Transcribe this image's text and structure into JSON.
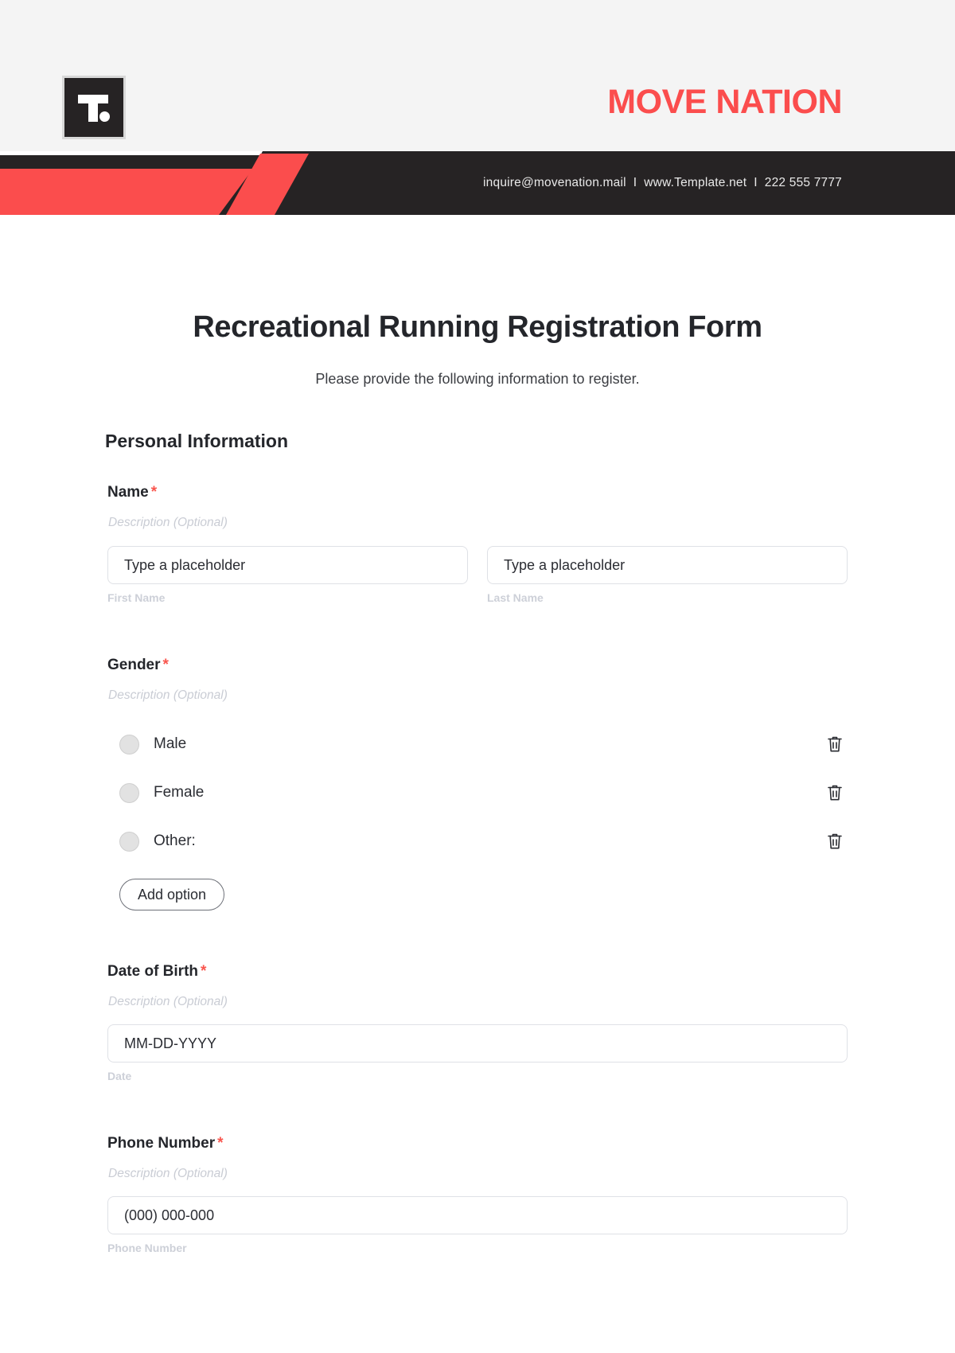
{
  "header": {
    "logo_letter": "T.",
    "brand": "MOVE NATION",
    "contact": {
      "email": "inquire@movenation.mail",
      "website": "www.Template.net",
      "phone": "222 555 7777",
      "separator": "I"
    },
    "colors": {
      "accent_red": "#fb4d4d",
      "dark": "#262324",
      "header_bg": "#f4f4f4"
    }
  },
  "form": {
    "title": "Recreational Running Registration Form",
    "subtitle": "Please provide the following information to register.",
    "section_heading": "Personal Information",
    "required_mark": "*",
    "description_placeholder": "Description (Optional)",
    "fields": [
      {
        "label": "Name",
        "required": true,
        "description": "Description (Optional)",
        "type": "name",
        "inputs": [
          {
            "value": "Type a placeholder",
            "sublabel": "First Name"
          },
          {
            "value": "Type a placeholder",
            "sublabel": "Last Name"
          }
        ]
      },
      {
        "label": "Gender",
        "required": true,
        "description": "Description (Optional)",
        "type": "radio",
        "options": [
          {
            "label": "Male"
          },
          {
            "label": "Female"
          },
          {
            "label": "Other:"
          }
        ],
        "add_option_label": "Add option",
        "delete_icon": "trash-icon"
      },
      {
        "label": "Date of Birth",
        "required": true,
        "description": "Description (Optional)",
        "type": "date",
        "inputs": [
          {
            "value": "MM-DD-YYYY",
            "sublabel": "Date"
          }
        ]
      },
      {
        "label": "Phone Number",
        "required": true,
        "description": "Description (Optional)",
        "type": "phone",
        "inputs": [
          {
            "value": "(000) 000-000",
            "sublabel": "Phone Number"
          }
        ]
      }
    ]
  }
}
